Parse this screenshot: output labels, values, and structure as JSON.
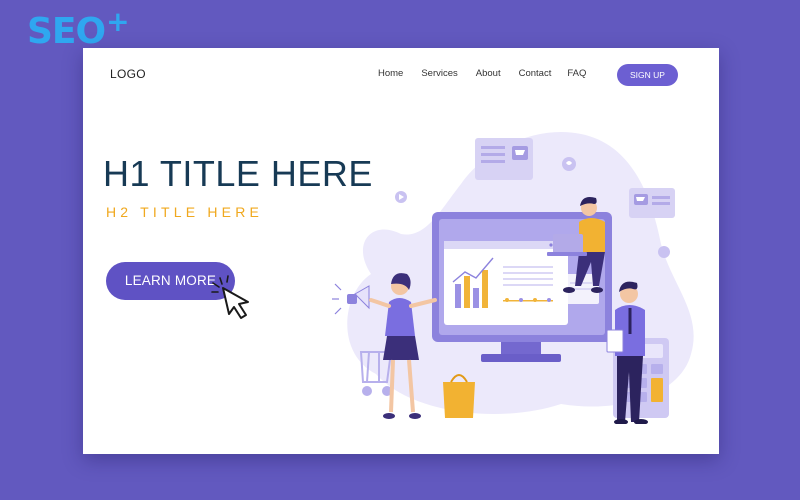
{
  "brand": {
    "text": "SEO",
    "plus": "+"
  },
  "header": {
    "logo": "LOGO",
    "nav": [
      "Home",
      "Services",
      "About",
      "Contact",
      "FAQ"
    ],
    "signup_label": "SIGN UP"
  },
  "hero": {
    "h1": "H1 TITLE HERE",
    "h2": "H2 TITLE HERE",
    "cta_label": "LEARN MORE"
  },
  "colors": {
    "background": "#6259bf",
    "accent": "#5f52c4",
    "title": "#173a55",
    "subtitle": "#f0a81e",
    "brand": "#2fa7f0"
  }
}
